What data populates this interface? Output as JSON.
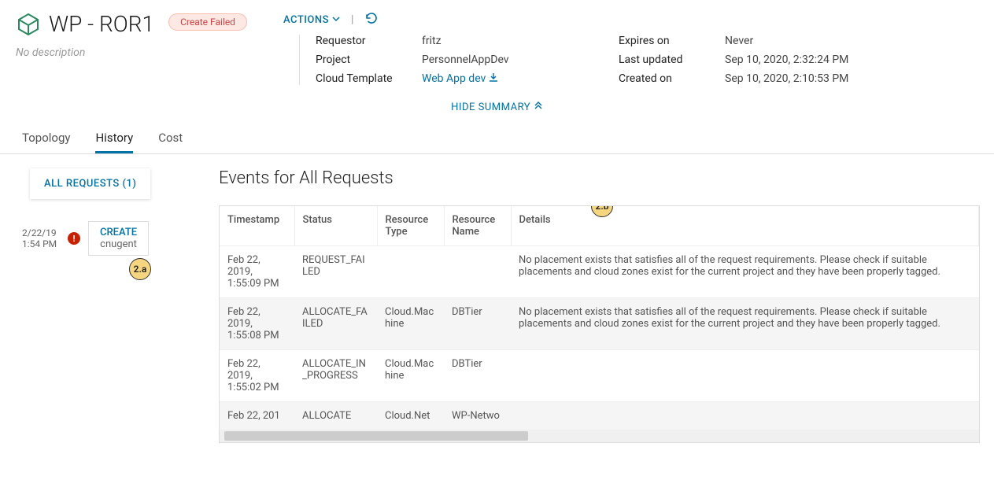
{
  "header": {
    "title": "WP - ROR1",
    "status_badge": "Create Failed",
    "actions_label": "ACTIONS",
    "no_description": "No description",
    "hide_summary": "HIDE SUMMARY"
  },
  "summary": {
    "left": [
      {
        "label": "Requestor",
        "value": "fritz"
      },
      {
        "label": "Project",
        "value": "PersonnelAppDev"
      },
      {
        "label": "Cloud Template",
        "value": "Web App dev",
        "link": true
      }
    ],
    "right": [
      {
        "label": "Expires on",
        "value": "Never"
      },
      {
        "label": "Last updated",
        "value": "Sep 10, 2020, 2:32:24 PM"
      },
      {
        "label": "Created on",
        "value": "Sep 10, 2020, 2:10:53 PM"
      }
    ]
  },
  "tabs": {
    "topology": "Topology",
    "history": "History",
    "cost": "Cost"
  },
  "sidebar": {
    "all_requests": "ALL REQUESTS (1)",
    "item": {
      "date": "2/22/19",
      "time": "1:54 PM",
      "action": "CREATE",
      "user": "cnugent"
    }
  },
  "events": {
    "title": "Events for All Requests",
    "columns": {
      "timestamp": "Timestamp",
      "status": "Status",
      "resource_type": "Resource Type",
      "resource_name": "Resource Name",
      "details": "Details"
    },
    "rows": [
      {
        "ts": "Feb 22, 2019, 1:55:09 PM",
        "status": "REQUEST_FAILED",
        "rtype": "",
        "rname": "",
        "details": "No placement exists that satisfies all of the request requirements. Please check if suitable placements and cloud zones exist for the current project and they have been properly tagged."
      },
      {
        "ts": "Feb 22, 2019, 1:55:08 PM",
        "status": "ALLOCATE_FAILED",
        "rtype": "Cloud.Machine",
        "rname": "DBTier",
        "details": "No placement exists that satisfies all of the request requirements. Please check if suitable placements and cloud zones exist for the current project and they have been properly tagged."
      },
      {
        "ts": "Feb 22, 2019, 1:55:02 PM",
        "status": "ALLOCATE_IN_PROGRESS",
        "rtype": "Cloud.Machine",
        "rname": "DBTier",
        "details": ""
      },
      {
        "ts": "Feb 22, 201",
        "status": "ALLOCATE",
        "rtype": "Cloud.Net",
        "rname": "WP-Netwo",
        "details": ""
      }
    ]
  },
  "callouts": {
    "a": "2.a",
    "b": "2.b"
  }
}
